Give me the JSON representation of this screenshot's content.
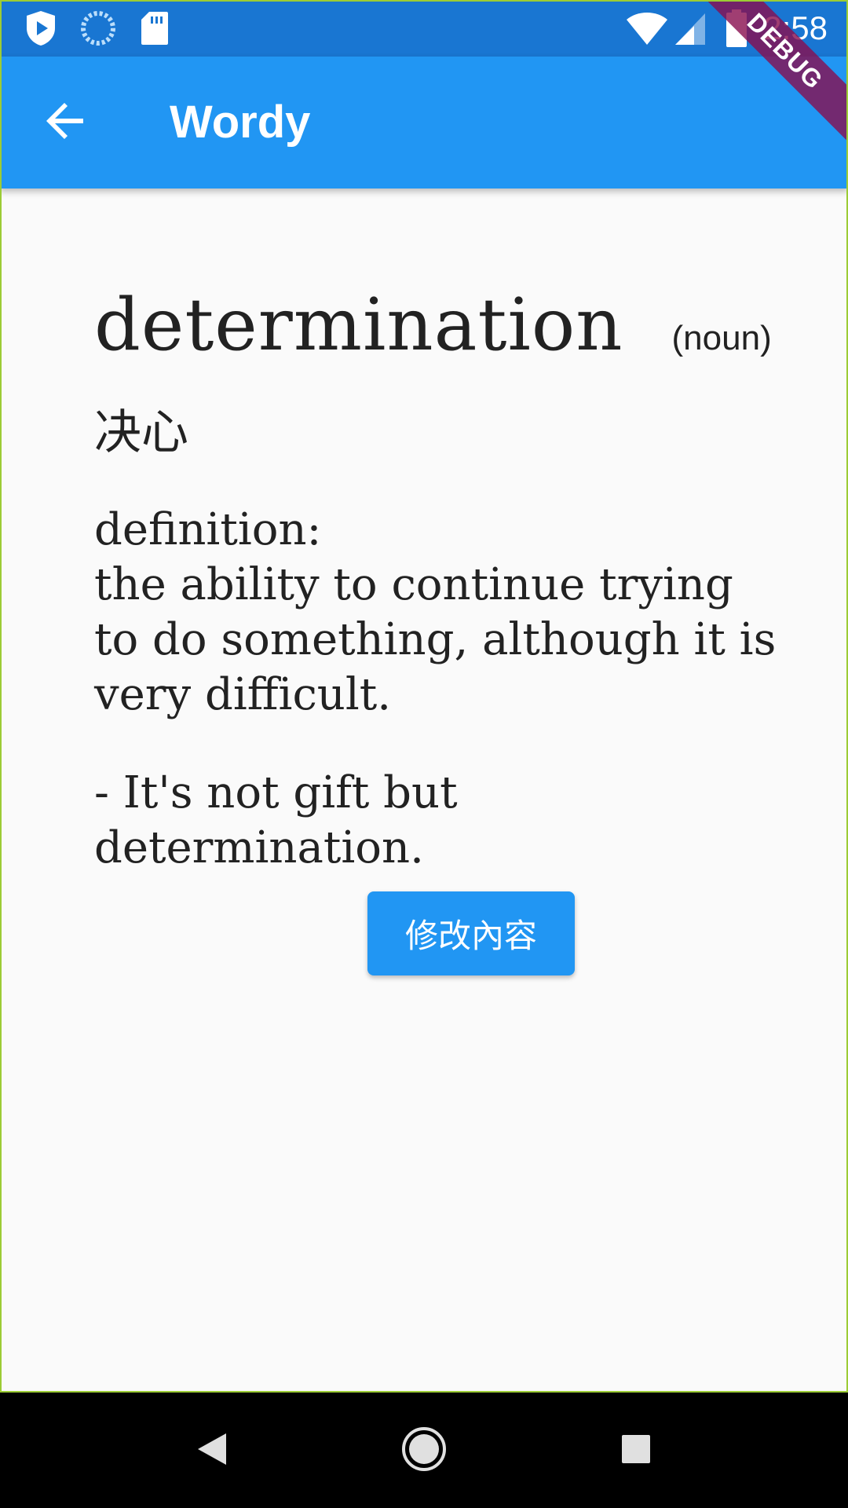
{
  "status_bar": {
    "time": "2:58",
    "icons_left": [
      "shield-play-icon",
      "sync-spinner-icon",
      "sd-card-icon"
    ],
    "icons_right": [
      "wifi-icon",
      "cell-signal-icon",
      "battery-icon"
    ]
  },
  "app_bar": {
    "title": "Wordy",
    "back_icon": "arrow-back-icon"
  },
  "debug_banner": "DEBUG",
  "entry": {
    "word": "determination",
    "part_of_speech": "(noun)",
    "translation": "决心",
    "definition_label": "definition:",
    "definition": "the ability to continue trying to do something, although it is very difficult.",
    "example": "- It's not gift but determination."
  },
  "edit_button_label": "修改內容",
  "nav_bar": {
    "back": "nav-back-icon",
    "home": "nav-home-icon",
    "recents": "nav-recents-icon"
  },
  "colors": {
    "status_bar": "#1976D2",
    "app_bar": "#2196F3",
    "button": "#2196F3",
    "background": "#FAFAFA",
    "debug_banner": "#880E4F"
  }
}
